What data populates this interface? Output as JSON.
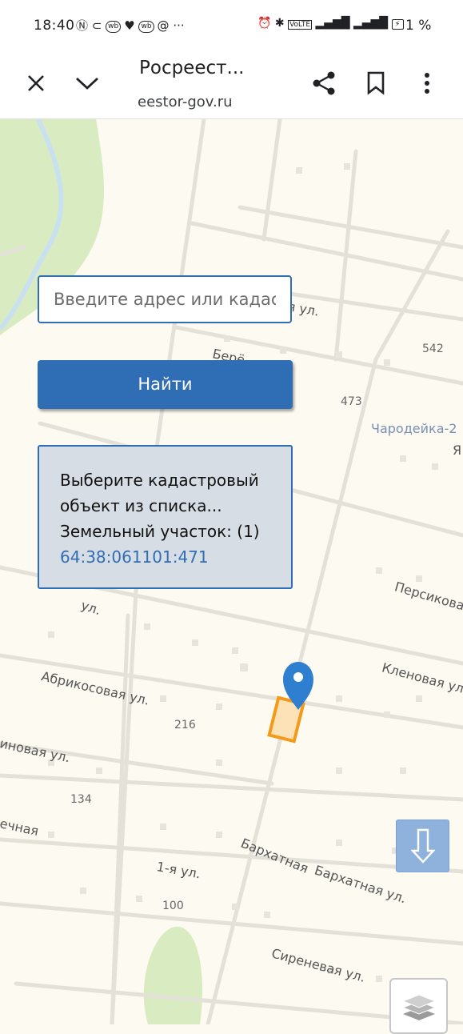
{
  "status_bar": {
    "time": "18:40",
    "left_icons": [
      "nfc-icon",
      "shoe-icon",
      "wb-icon",
      "heart-icon",
      "wb-icon",
      "at-icon",
      "more-icon"
    ],
    "chip_wb": "wb",
    "battery": "1 %"
  },
  "toolbar": {
    "title": "Росреест...",
    "url": "eestor-gov.ru"
  },
  "search": {
    "placeholder": "Введите адрес или кадаст"
  },
  "find_button": {
    "label": "Найти"
  },
  "result": {
    "line1": "Выберите кадастровый",
    "line2": "объект из списка...",
    "line3": "Земельный участок: (1)",
    "link": "64:38:061101:471"
  },
  "map": {
    "streets": {
      "street_a": "я ул.",
      "bere": "Берё",
      "chrodeika": "Чародейка-2",
      "ya": "Я",
      "persikovaya": "Персиковая",
      "klenovaya": "Кленовая ул.",
      "ul_left": "ул.",
      "abrikosovaya": "Абрикосовая ул.",
      "inovaya": "иновая ул.",
      "echnaya": "ечная",
      "pervaya": "1-я ул.",
      "barkhatnaya1": "Бархатная",
      "barkhatnaya2": "Бархатная ул.",
      "sirenevaya": "Сиреневая ул."
    },
    "numbers": {
      "n542": "542",
      "n473": "473",
      "n216": "216",
      "n134": "134",
      "n100": "100"
    },
    "colors": {
      "background": "#fcfaf1",
      "green": "#d9ecc1",
      "road": "#e2e0da",
      "parcel_fill": "#fde2b7",
      "parcel_stroke": "#f39a1a",
      "marker": "#2f7fd0"
    }
  },
  "controls": {
    "arrow_icon": "arrow-down-icon",
    "layers_icon": "layers-icon"
  }
}
